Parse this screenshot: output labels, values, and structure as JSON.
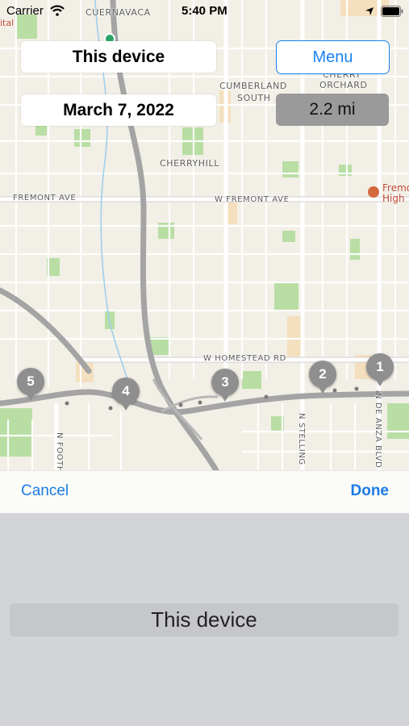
{
  "status_bar": {
    "carrier": "Carrier",
    "time": "5:40 PM"
  },
  "controls": {
    "device_label": "This device",
    "menu_label": "Menu",
    "date_label": "March 7, 2022",
    "distance_label": "2.2 mi"
  },
  "map": {
    "labels": {
      "cuernavaca": "CUERNAVACA",
      "cumberland": "CUMBERLAND",
      "south": "SOUTH",
      "cherry": "CHERRY",
      "orchard": "ORCHARD",
      "cherryhill": "CHERRYHILL",
      "fremont_ave": "FREMONT AVE",
      "w_fremont_ave": "W FREMONT AVE",
      "w_homestead_rd": "W HOMESTEAD RD",
      "n_stelling": "N STELLING",
      "n_de_anza": "N DE ANZA BLVD",
      "n_foothill": "N FOOTH",
      "fremont_high_1": "Fremo",
      "fremont_high_2": "High",
      "hospital_fragment": "ital"
    },
    "markers": [
      "1",
      "2",
      "3",
      "4",
      "5"
    ]
  },
  "toolbar": {
    "cancel_label": "Cancel",
    "done_label": "Done"
  },
  "picker": {
    "selected": "This device"
  },
  "colors": {
    "accent": "#1a7be6",
    "marker": "#8f8f8f",
    "road": "#a4a4a4",
    "park": "#b5dca0"
  }
}
